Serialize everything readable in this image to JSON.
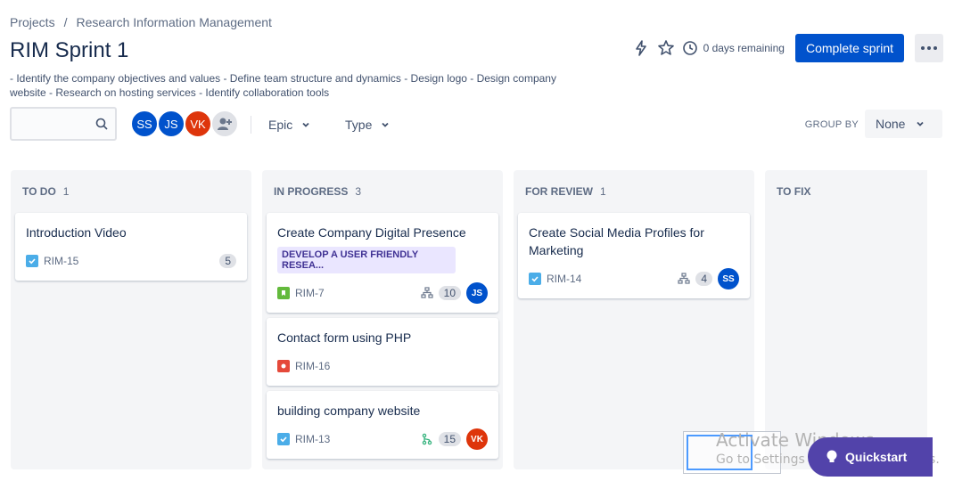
{
  "breadcrumb": {
    "projects": "Projects",
    "separator": "/",
    "project": "Research Information Management"
  },
  "header": {
    "title": "RIM Sprint 1",
    "description": "- Identify the company objectives and values - Define team structure and dynamics - Design logo - Design company website - Research on hosting services - Identify collaboration tools",
    "remaining": "0 days remaining",
    "complete_label": "Complete sprint"
  },
  "filters": {
    "search_placeholder": "",
    "avatars": [
      {
        "initials": "SS",
        "color": "#0052cc"
      },
      {
        "initials": "JS",
        "color": "#0052cc"
      },
      {
        "initials": "VK",
        "color": "#de350b"
      }
    ],
    "epic_label": "Epic",
    "type_label": "Type",
    "group_by_label": "GROUP BY",
    "group_by_value": "None"
  },
  "columns": [
    {
      "name": "TO DO",
      "count": "1",
      "cards": [
        {
          "title": "Introduction Video",
          "key": "RIM-15",
          "type": "task",
          "estimate": "5"
        }
      ]
    },
    {
      "name": "IN PROGRESS",
      "count": "3",
      "cards": [
        {
          "title": "Create Company Digital Presence",
          "epic": "DEVELOP A USER FRIENDLY RESEA...",
          "key": "RIM-7",
          "type": "story",
          "subtasks": true,
          "estimate": "10",
          "assignee": "JS",
          "assignee_color": "#0052cc"
        },
        {
          "title": "Contact form using PHP",
          "key": "RIM-16",
          "type": "bug"
        },
        {
          "title": "building company website",
          "key": "RIM-13",
          "type": "task",
          "branch": true,
          "estimate": "15",
          "assignee": "VK",
          "assignee_color": "#de350b"
        }
      ]
    },
    {
      "name": "FOR REVIEW",
      "count": "1",
      "cards": [
        {
          "title": "Create Social Media Profiles for Marketing",
          "key": "RIM-14",
          "type": "task",
          "subtasks": true,
          "estimate": "4",
          "assignee": "SS",
          "assignee_color": "#0052cc"
        }
      ]
    },
    {
      "name": "TO FIX",
      "count": "",
      "cards": []
    }
  ],
  "watermark": {
    "title": "Activate Windows",
    "subtitle": "Go to Settings to activate Windows."
  },
  "quickstart": {
    "label": "Quickstart"
  },
  "colors": {
    "primary": "#0052cc",
    "task": "#4bade8",
    "story": "#63ba3c",
    "bug": "#e5493a",
    "quickstart": "#5243aa"
  }
}
